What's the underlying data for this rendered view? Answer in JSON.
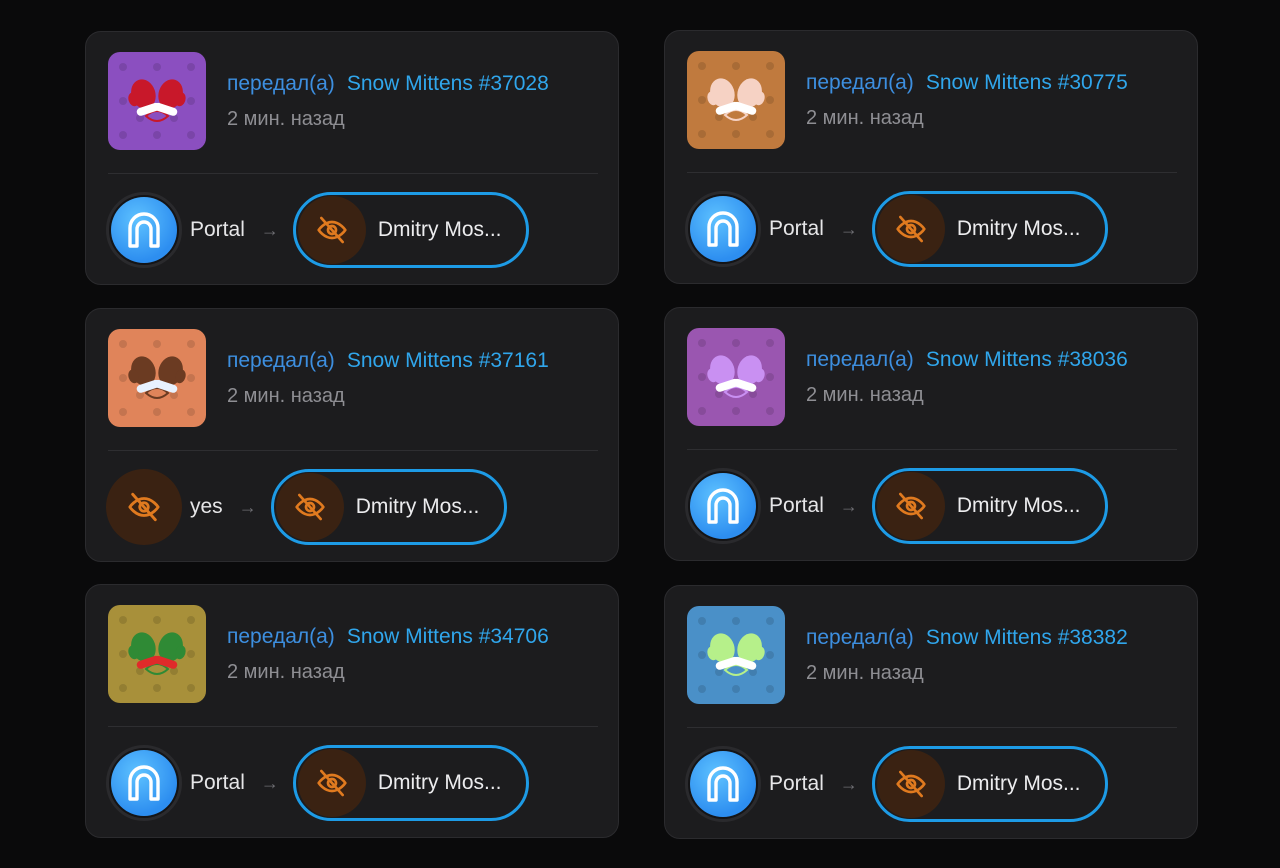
{
  "colors": {
    "background": "#0a0a0b",
    "card": "#1c1c1e",
    "action_text": "#3d8fe0",
    "gift_text": "#30a6ec",
    "recipient_border": "#1d9be6",
    "hidden_icon": "#e07a1f"
  },
  "cards": [
    {
      "action": "передал(а)",
      "gift": "Snow Mittens #37028",
      "time": "2 мин. назад",
      "sender": "Portal",
      "sender_icon": "portal-logo-icon",
      "recipient": "Dmitry Mos...",
      "thumb_bg": "#8b4fc0",
      "mitten_color": "#c8182a",
      "accent_color": "#ffffff"
    },
    {
      "action": "передал(а)",
      "gift": "Snow Mittens #30775",
      "time": "2 мин. назад",
      "sender": "Portal",
      "sender_icon": "portal-logo-icon",
      "recipient": "Dmitry Mos...",
      "thumb_bg": "#c07a3e",
      "mitten_color": "#f6d2c4",
      "accent_color": "#ffffff"
    },
    {
      "action": "передал(а)",
      "gift": "Snow Mittens #37161",
      "time": "2 мин. назад",
      "sender": "yes",
      "sender_icon": "eye-off-icon",
      "recipient": "Dmitry Mos...",
      "thumb_bg": "#e0845a",
      "mitten_color": "#6b3b22",
      "accent_color": "#e8f2ff"
    },
    {
      "action": "передал(а)",
      "gift": "Snow Mittens #38036",
      "time": "2 мин. назад",
      "sender": "Portal",
      "sender_icon": "portal-logo-icon",
      "recipient": "Dmitry Mos...",
      "thumb_bg": "#9a56b0",
      "mitten_color": "#c990f2",
      "accent_color": "#ffffff"
    },
    {
      "action": "передал(а)",
      "gift": "Snow Mittens #34706",
      "time": "2 мин. назад",
      "sender": "Portal",
      "sender_icon": "portal-logo-icon",
      "recipient": "Dmitry Mos...",
      "thumb_bg": "#a8903a",
      "mitten_color": "#2f8a35",
      "accent_color": "#e02a2a"
    },
    {
      "action": "передал(а)",
      "gift": "Snow Mittens #38382",
      "time": "2 мин. назад",
      "sender": "Portal",
      "sender_icon": "portal-logo-icon",
      "recipient": "Dmitry Mos...",
      "thumb_bg": "#4a90c8",
      "mitten_color": "#b6f08a",
      "accent_color": "#ffffff"
    }
  ]
}
